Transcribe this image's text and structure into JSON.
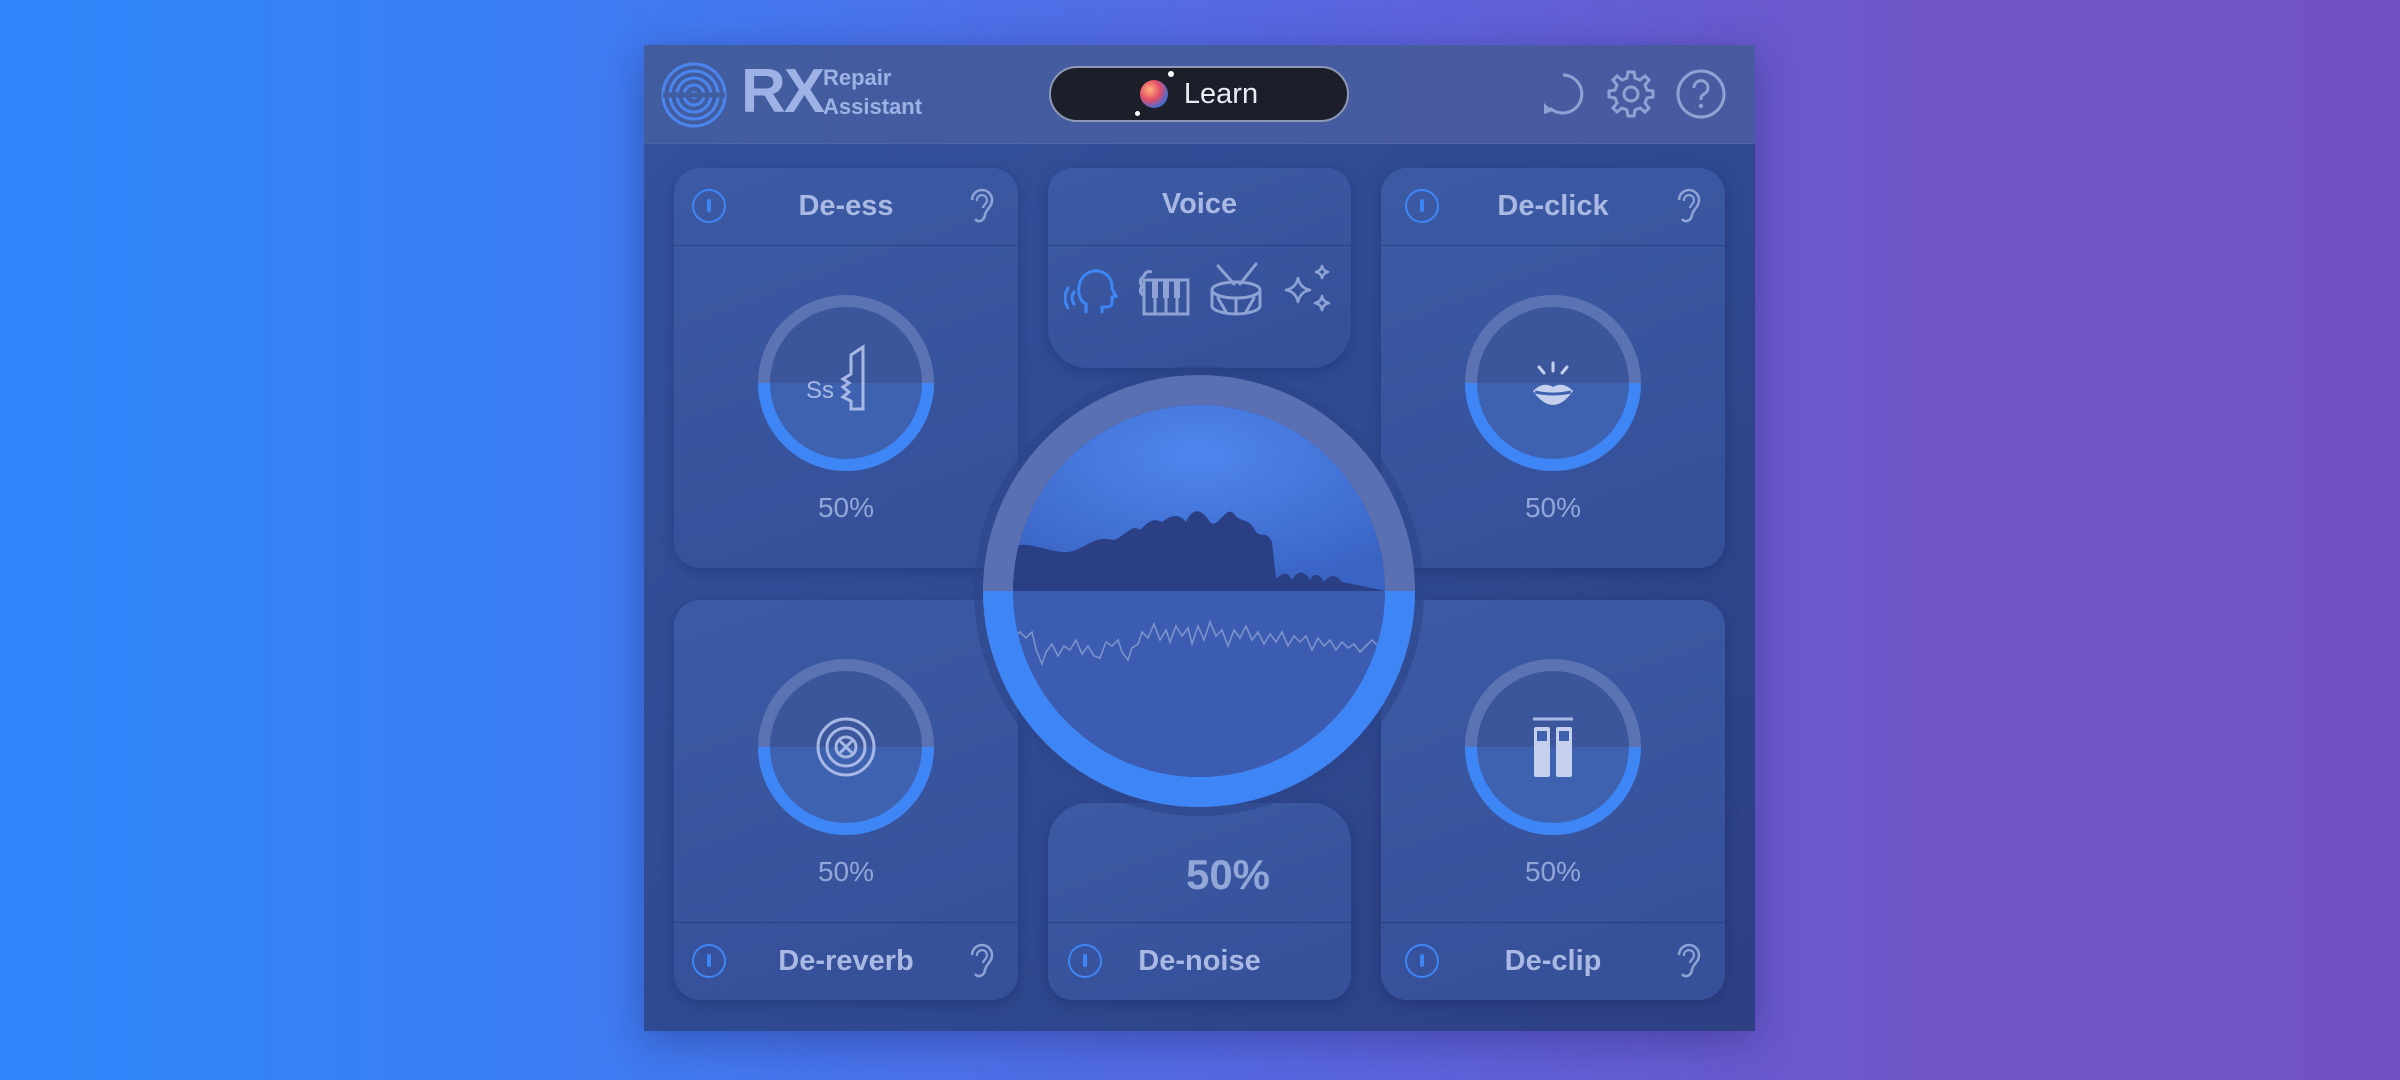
{
  "header": {
    "logo_main": "RX",
    "logo_sub_line1": "Repair",
    "logo_sub_line2": "Assistant",
    "learn_label": "Learn"
  },
  "modules": {
    "de_ess": {
      "title": "De-ess",
      "percent_label": "50%",
      "amount": 0.5
    },
    "de_click": {
      "title": "De-click",
      "percent_label": "50%",
      "amount": 0.5
    },
    "de_reverb": {
      "title": "De-reverb",
      "percent_label": "50%",
      "amount": 0.5
    },
    "de_clip": {
      "title": "De-clip",
      "percent_label": "50%",
      "amount": 0.5
    },
    "de_noise": {
      "title": "De-noise",
      "percent_label": "50%",
      "amount": 0.5
    }
  },
  "voice_selector": {
    "title": "Voice",
    "options": [
      "voice-icon",
      "instrument-icon",
      "drum-icon",
      "sparkle-icon"
    ],
    "selected": "voice-icon"
  },
  "colors": {
    "accent": "#3e86f5",
    "text_muted": "#aab9e3",
    "panel": "#3a56a0",
    "learn_button": "#1c1f2a"
  }
}
